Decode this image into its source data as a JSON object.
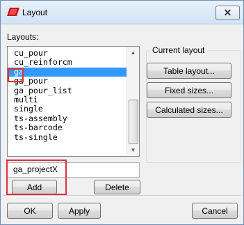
{
  "window": {
    "title": "Layout",
    "close_glyph": "✕"
  },
  "layouts": {
    "label": "Layouts:",
    "items": [
      "cu_pour",
      "cu_reinforcm",
      "ga",
      "ga_pour",
      "ga_pour_list",
      "multi",
      "single",
      "ts-assembly",
      "ts-barcode",
      "ts-single"
    ],
    "selected": "ga"
  },
  "name_input": {
    "value": "ga_projectX"
  },
  "buttons": {
    "add": "Add",
    "delete": "Delete",
    "ok": "OK",
    "apply": "Apply",
    "cancel": "Cancel"
  },
  "current_layout": {
    "title": "Current layout",
    "table_layout": "Table layout...",
    "fixed_sizes": "Fixed sizes...",
    "calculated_sizes": "Calculated sizes..."
  },
  "icons": {
    "app": "app-icon",
    "close": "close-icon",
    "scroll_up": "scroll-up-icon",
    "scroll_down": "scroll-down-icon"
  },
  "colors": {
    "selection": "#3399ff",
    "highlight": "#e0303a"
  }
}
